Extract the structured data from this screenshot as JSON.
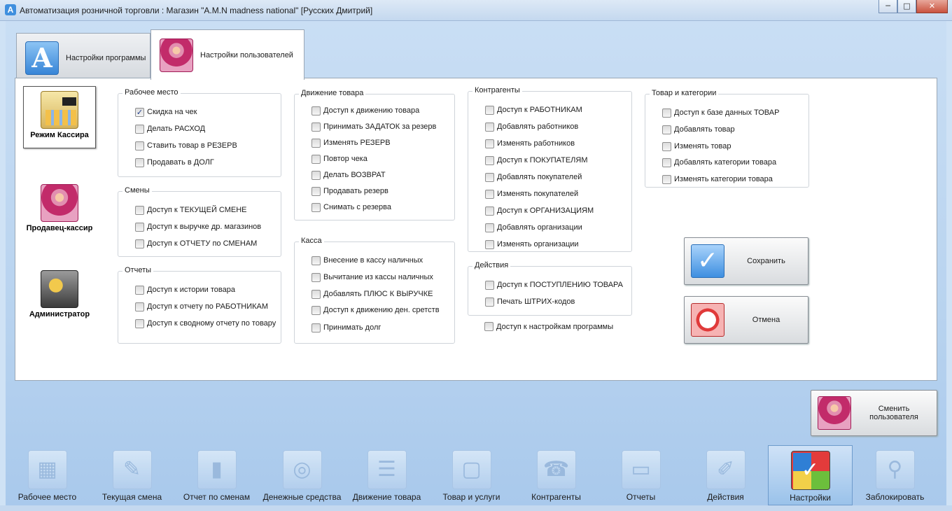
{
  "window": {
    "title": "Автоматизация розничной торговли : Магазин \"A.M.N madness national\" [Русских Дмитрий]",
    "app_icon": "A",
    "controls": {
      "minimize": "─",
      "maximize": "□",
      "close": "✕"
    }
  },
  "tabs": [
    {
      "label": "Настройки программы",
      "icon": "app-a-icon",
      "active": false
    },
    {
      "label": "Настройки пользователей",
      "icon": "user-icon",
      "active": true
    }
  ],
  "modes": [
    {
      "label": "Режим Кассира",
      "icon": "cash-register-icon",
      "selected": true
    },
    {
      "label": "Продавец-кассир",
      "icon": "user-icon",
      "selected": false
    },
    {
      "label": "Администратор",
      "icon": "key-icon",
      "selected": false
    }
  ],
  "groups": {
    "workplace": {
      "title": "Рабочее место",
      "items": [
        {
          "label": "Скидка на чек",
          "checked": true
        },
        {
          "label": "Делать РАСХОД",
          "checked": false
        },
        {
          "label": "Ставить товар в РЕЗЕРВ",
          "checked": false
        },
        {
          "label": "Продавать в ДОЛГ",
          "checked": false
        }
      ]
    },
    "shifts": {
      "title": "Смены",
      "items": [
        {
          "label": "Доступ к ТЕКУЩЕЙ СМЕНЕ",
          "checked": false
        },
        {
          "label": "Доступ к выручке др. магазинов",
          "checked": false
        },
        {
          "label": "Доступ к ОТЧЕТУ по СМЕНАМ",
          "checked": false
        }
      ]
    },
    "reports": {
      "title": "Отчеты",
      "items": [
        {
          "label": "Доступ к истории товара",
          "checked": false
        },
        {
          "label": "Доступ к отчету по РАБОТНИКАМ",
          "checked": false
        },
        {
          "label": "Доступ к сводному отчету по товару",
          "checked": false
        }
      ]
    },
    "goods_movement": {
      "title": "Движение товара",
      "items": [
        {
          "label": "Доступ к движению товара",
          "checked": false
        },
        {
          "label": "Принимать ЗАДАТОК за резерв",
          "checked": false
        },
        {
          "label": "Изменять РЕЗЕРВ",
          "checked": false
        },
        {
          "label": "Повтор чека",
          "checked": false
        },
        {
          "label": "Делать ВОЗВРАТ",
          "checked": false
        },
        {
          "label": "Продавать резерв",
          "checked": false
        },
        {
          "label": "Снимать с резерва",
          "checked": false
        }
      ]
    },
    "cash": {
      "title": "Касса",
      "items": [
        {
          "label": "Внесение в кассу наличных",
          "checked": false
        },
        {
          "label": "Вычитание из кассы наличных",
          "checked": false
        },
        {
          "label": "Добавлять ПЛЮС К ВЫРУЧКЕ",
          "checked": false
        },
        {
          "label": "Доступ к движению ден. сретств",
          "checked": false
        },
        {
          "label": "Принимать долг",
          "checked": false
        }
      ]
    },
    "counterparties": {
      "title": "Контрагенты",
      "items": [
        {
          "label": "Доступ к РАБОТНИКАМ",
          "checked": false
        },
        {
          "label": "Добавлять работников",
          "checked": false
        },
        {
          "label": "Изменять работников",
          "checked": false
        },
        {
          "label": "Доступ к ПОКУПАТЕЛЯМ",
          "checked": false
        },
        {
          "label": "Добавлять покупателей",
          "checked": false
        },
        {
          "label": "Изменять покупателей",
          "checked": false
        },
        {
          "label": "Доступ к ОРГАНИЗАЦИЯМ",
          "checked": false
        },
        {
          "label": "Добавлять организации",
          "checked": false
        },
        {
          "label": "Изменять организации",
          "checked": false
        }
      ]
    },
    "actions": {
      "title": "Действия",
      "items": [
        {
          "label": "Доступ к ПОСТУПЛЕНИЮ ТОВАРА",
          "checked": false
        },
        {
          "label": "Печать ШТРИХ-кодов",
          "checked": false
        }
      ]
    },
    "goods_categories": {
      "title": "Товар и категории",
      "items": [
        {
          "label": "Доступ к базе данных ТОВАР",
          "checked": false
        },
        {
          "label": "Добавлять товар",
          "checked": false
        },
        {
          "label": "Изменять товар",
          "checked": false
        },
        {
          "label": "Добавлять категории товара",
          "checked": false
        },
        {
          "label": "Изменять категории товара",
          "checked": false
        }
      ]
    }
  },
  "program_settings_access": {
    "label": "Доступ к настройкам программы",
    "checked": false
  },
  "buttons": {
    "save": {
      "label": "Сохранить",
      "icon": "checkmark-icon"
    },
    "cancel": {
      "label": "Отмена",
      "icon": "cancel-icon"
    },
    "switch_user": {
      "label": "Сменить пользователя",
      "icon": "switch-user-icon"
    }
  },
  "nav": [
    {
      "label": "Рабочее место",
      "icon": "calculator-icon",
      "glyph": "▦",
      "active": false
    },
    {
      "label": "Текущая смена",
      "icon": "notepad-icon",
      "glyph": "✎",
      "active": false
    },
    {
      "label": "Отчет по сменам",
      "icon": "book-icon",
      "glyph": "▮",
      "active": false
    },
    {
      "label": "Денежные средства",
      "icon": "safe-icon",
      "glyph": "◎",
      "active": false
    },
    {
      "label": "Движение товара",
      "icon": "list-icon",
      "glyph": "☰",
      "active": false
    },
    {
      "label": "Товар и услуги",
      "icon": "box-icon",
      "glyph": "▢",
      "active": false
    },
    {
      "label": "Контрагенты",
      "icon": "phonebook-icon",
      "glyph": "☎",
      "active": false
    },
    {
      "label": "Отчеты",
      "icon": "tray-icon",
      "glyph": "▭",
      "active": false
    },
    {
      "label": "Действия",
      "icon": "ruler-pencil-icon",
      "glyph": "✐",
      "active": false
    },
    {
      "label": "Настройки",
      "icon": "settings-grid-icon",
      "glyph": "✓",
      "active": true
    },
    {
      "label": "Заблокировать",
      "icon": "keyhole-icon",
      "glyph": "⚲",
      "active": false
    }
  ]
}
